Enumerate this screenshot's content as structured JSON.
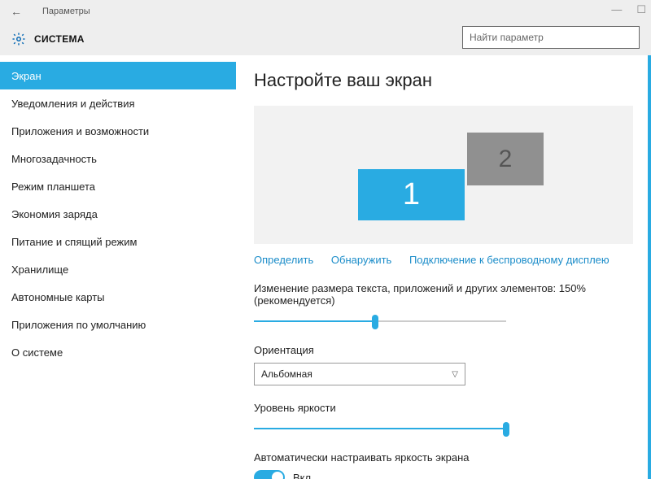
{
  "window": {
    "title": "Параметры",
    "back_icon": "←",
    "min_icon": "—",
    "max_icon": "☐"
  },
  "header": {
    "section": "СИСТЕМА",
    "search_placeholder": "Найти параметр"
  },
  "sidebar": {
    "items": [
      {
        "label": "Экран",
        "active": true
      },
      {
        "label": "Уведомления и действия"
      },
      {
        "label": "Приложения и возможности"
      },
      {
        "label": "Многозадачность"
      },
      {
        "label": "Режим планшета"
      },
      {
        "label": "Экономия заряда"
      },
      {
        "label": "Питание и спящий режим"
      },
      {
        "label": "Хранилище"
      },
      {
        "label": "Автономные карты"
      },
      {
        "label": "Приложения по умолчанию"
      },
      {
        "label": "О системе"
      }
    ]
  },
  "main": {
    "heading": "Настройте ваш экран",
    "monitors": {
      "m1": "1",
      "m2": "2"
    },
    "links": {
      "detect": "Определить",
      "identify": "Обнаружить",
      "wireless": "Подключение к беспроводному дисплею"
    },
    "scale_label": "Изменение размера текста, приложений и других элементов: 150% (рекомендуется)",
    "scale_value_percent": 48,
    "orientation_label": "Ориентация",
    "orientation_value": "Альбомная",
    "brightness_label": "Уровень яркости",
    "brightness_value_percent": 100,
    "auto_brightness_label": "Автоматически настраивать яркость экрана",
    "toggle_state": "Вкл."
  }
}
